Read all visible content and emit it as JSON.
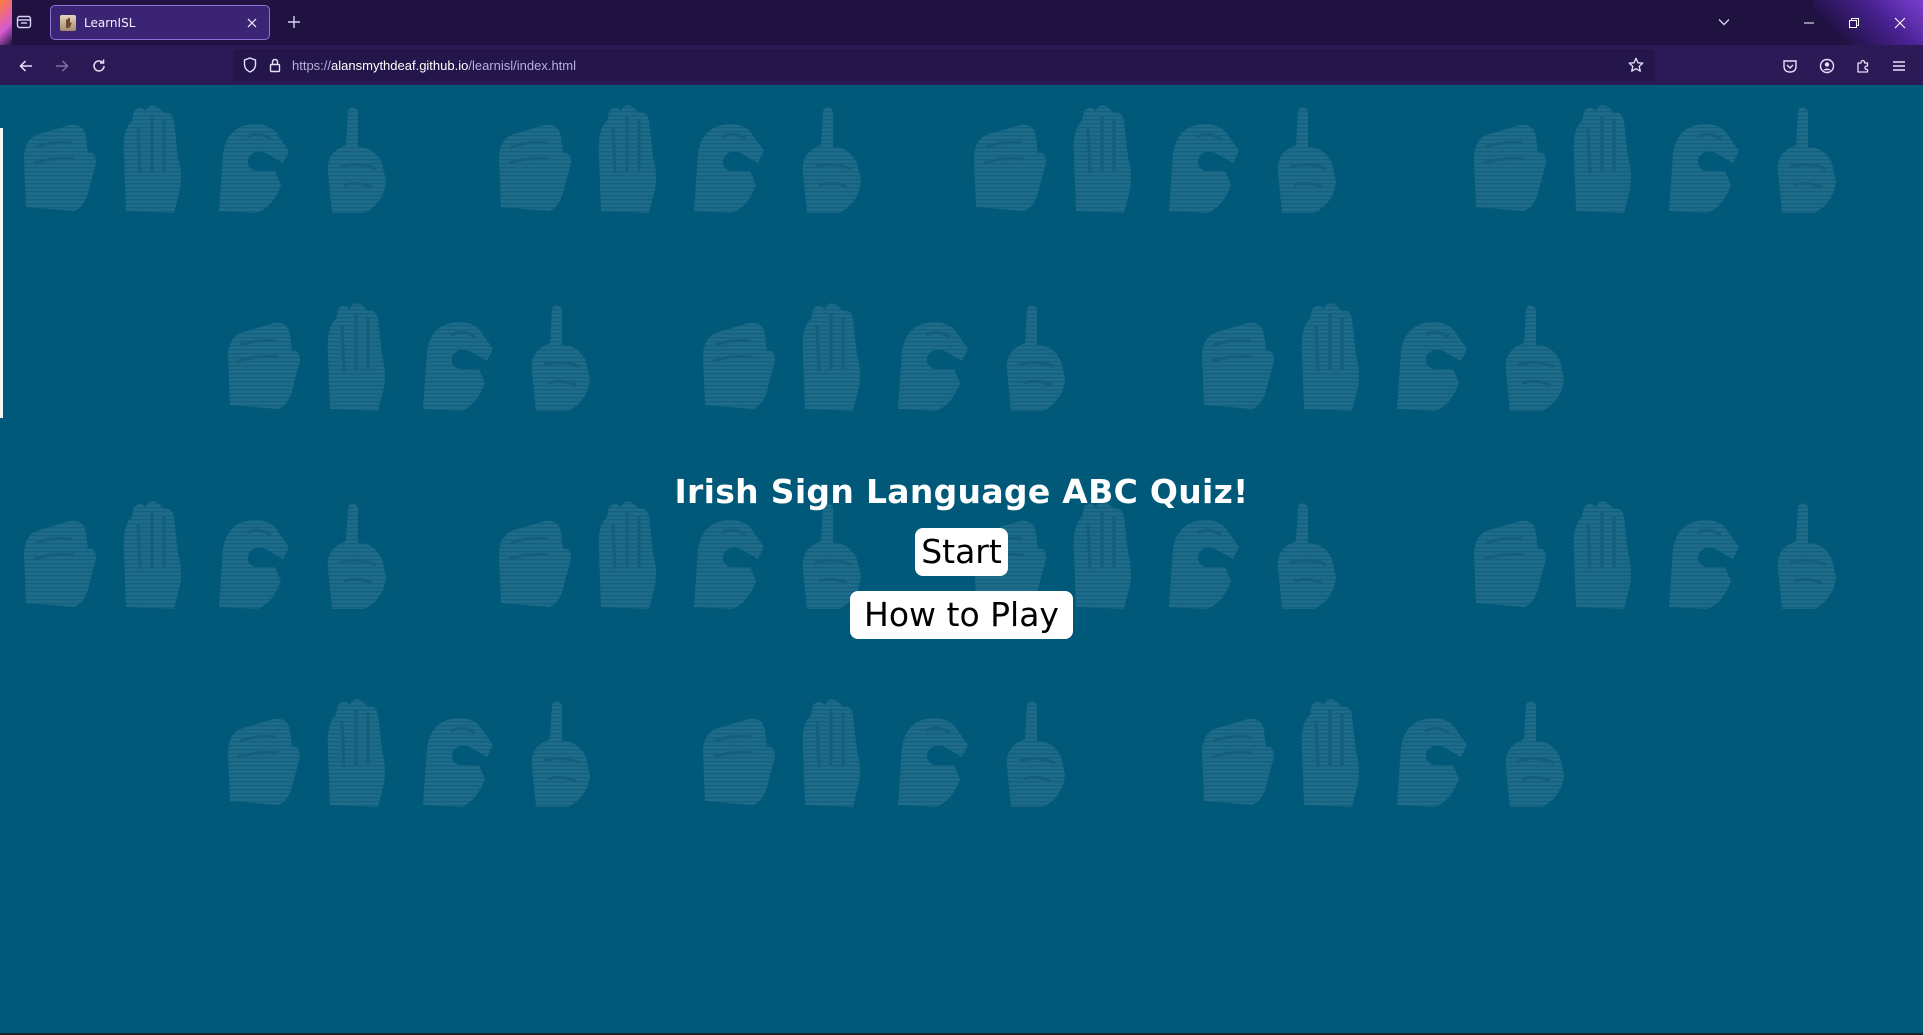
{
  "browser": {
    "tab": {
      "title": "LearnISL",
      "favicon": "hand-favicon",
      "close_icon": "close-icon"
    },
    "new_tab_icon": "plus-icon",
    "list_all_tabs_icon": "chevron-down-icon",
    "window_controls": [
      "minimize-icon",
      "restore-icon",
      "close-icon"
    ],
    "nav": {
      "back_icon": "arrow-left-icon",
      "forward_icon": "arrow-right-icon",
      "reload_icon": "reload-icon"
    },
    "url": {
      "scheme": "https://",
      "host": "alansmythdeaf.github.io",
      "path": "/learnisl/index.html"
    },
    "toolbar_icons": [
      "pocket-icon",
      "account-icon",
      "extensions-icon",
      "menu-icon"
    ]
  },
  "page": {
    "title": "Irish Sign Language ABC Quiz!",
    "start_label": "Start",
    "how_to_play_label": "How to Play",
    "background_color": "#01597a",
    "pattern_color": "#1d6f8e",
    "background_pattern_icon": "isl-abcd-handshapes-pattern"
  },
  "colors": {
    "tabstrip": "#1f1140",
    "navbar": "#2b1a55",
    "urlbar": "#24164a",
    "tab_active": "#3b2474",
    "button_bg": "#ffffff"
  }
}
